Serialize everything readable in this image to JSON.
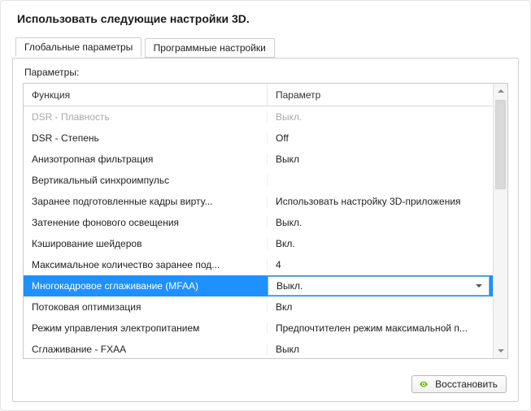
{
  "title": "Использовать следующие настройки 3D.",
  "tabs": {
    "global": "Глобальные параметры",
    "program": "Программные настройки"
  },
  "params_label": "Параметры:",
  "columns": {
    "func": "Функция",
    "param": "Параметр"
  },
  "rows": [
    {
      "func": "DSR - Плавность",
      "param": "Выкл.",
      "disabled": true
    },
    {
      "func": "DSR - Степень",
      "param": "Off"
    },
    {
      "func": "Анизотропная фильтрация",
      "param": "Выкл"
    },
    {
      "func": "Вертикальный синхроимпульс",
      "param": ""
    },
    {
      "func": "Заранее подготовленные кадры вирту...",
      "param": "Использовать настройку 3D-приложения"
    },
    {
      "func": "Затенение фонового освещения",
      "param": "Выкл."
    },
    {
      "func": "Кэширование шейдеров",
      "param": "Вкл."
    },
    {
      "func": "Максимальное количество заранее под...",
      "param": "4"
    },
    {
      "func": "Многокадровое сглаживание (MFAA)",
      "param": "Выкл.",
      "selected": true
    },
    {
      "func": "Потоковая оптимизация",
      "param": "Вкл"
    },
    {
      "func": "Режим управления электропитанием",
      "param": "Предпочтителен режим максимальной п..."
    },
    {
      "func": "Сглаживание - FXAA",
      "param": "Выкл"
    }
  ],
  "restore_label": "Восстановить"
}
